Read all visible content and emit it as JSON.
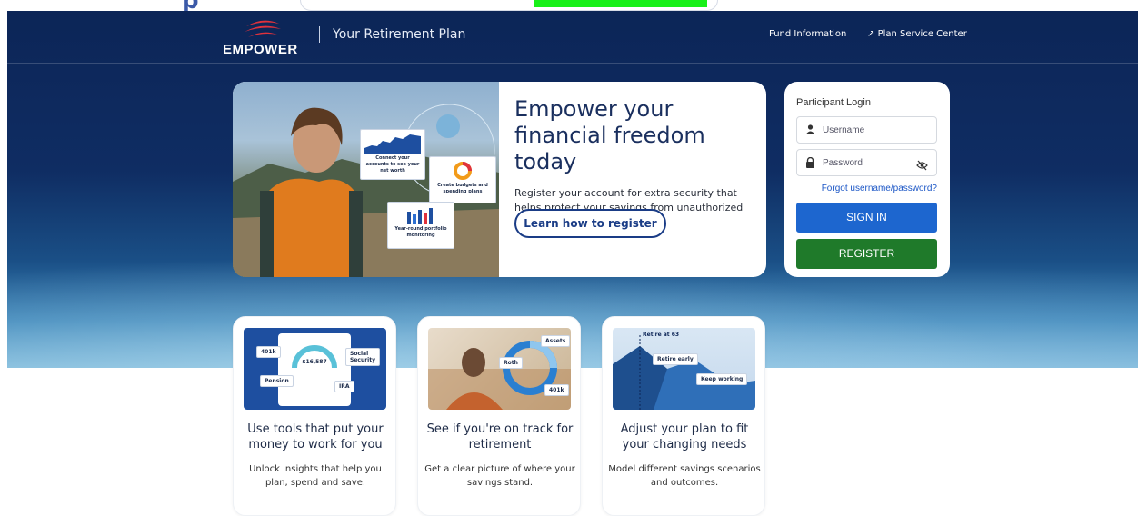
{
  "brand": {
    "logo_text": "EMPOWER",
    "plan_title": "Your Retirement Plan"
  },
  "header_nav": {
    "fund_info": "Fund Information",
    "plan_service": "Plan Service Center"
  },
  "hero": {
    "title": "Empower your financial freedom today",
    "body": "Register your account for extra security that helps protect your savings from unauthorized access.",
    "cta": "Learn how to register",
    "overlays": {
      "net_worth": "Connect your accounts to see your net worth",
      "budgets": "Create budgets and spending plans",
      "monitoring": "Year-round portfolio monitoring"
    }
  },
  "login": {
    "title": "Participant Login",
    "username_placeholder": "Username",
    "password_placeholder": "Password",
    "forgot": "Forgot username/password?",
    "sign_in": "SIGN IN",
    "register": "REGISTER"
  },
  "cards": [
    {
      "title": "Use tools that put your money to work for you",
      "body": "Unlock insights that help you plan, spend and save.",
      "image_labels": {
        "k401": "401k",
        "social": "Social Security",
        "pension": "Pension",
        "ira": "IRA",
        "amount": "$16,587"
      }
    },
    {
      "title": "See if you're on track for retirement",
      "body": "Get a clear picture of where your savings stand.",
      "image_labels": {
        "assets": "Assets",
        "roth": "Roth",
        "k401": "401k"
      }
    },
    {
      "title": "Adjust your plan to fit your changing needs",
      "body": "Model different savings scenarios and outcomes.",
      "image_labels": {
        "retire_at": "Retire at 63",
        "retire_early": "Retire early",
        "keep_working": "Keep working"
      }
    }
  ],
  "colors": {
    "navy": "#0c2557",
    "signin_blue": "#1d66cf",
    "register_green": "#1f7a2a",
    "highlight": "#18f018"
  }
}
